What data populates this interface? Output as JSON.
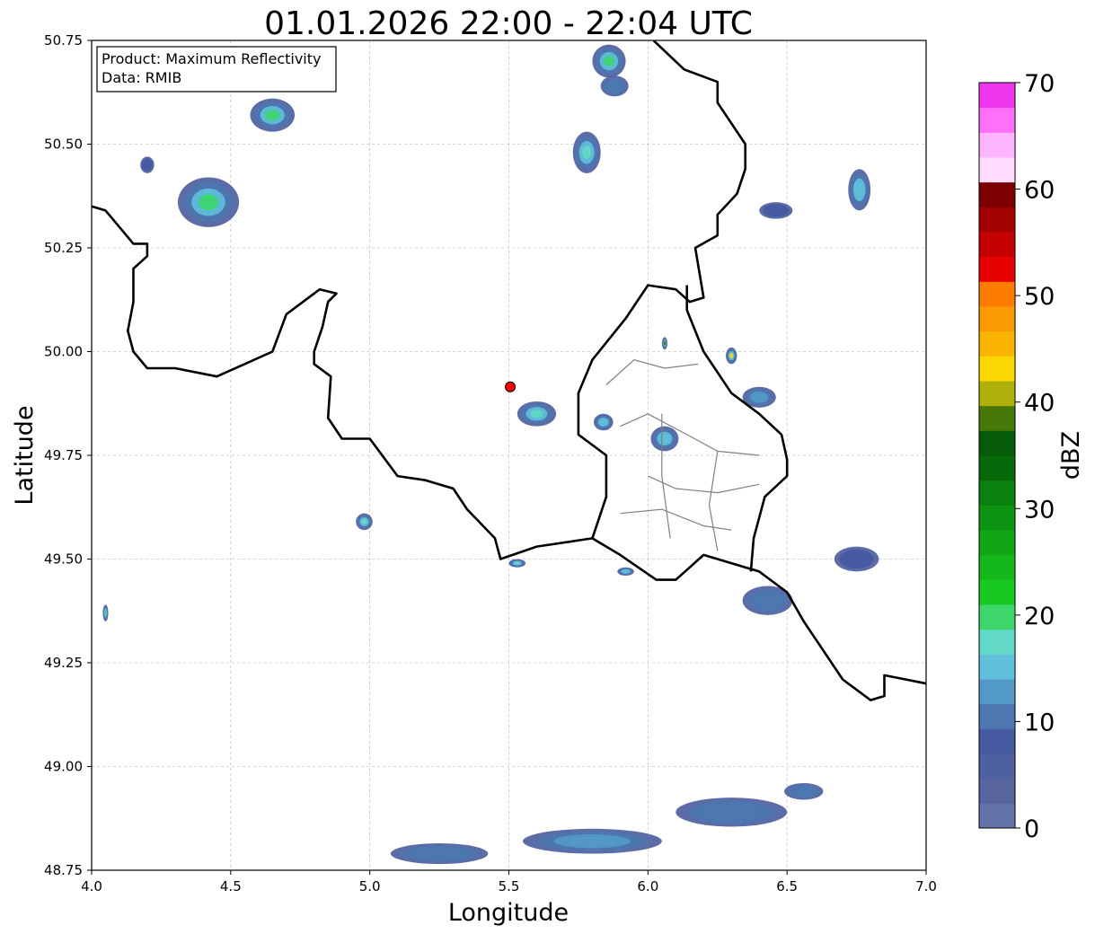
{
  "chart_data": {
    "type": "heatmap",
    "title": "01.01.2026 22:00 - 22:04 UTC",
    "xlabel": "Longitude",
    "ylabel": "Latitude",
    "xlim": [
      4.0,
      7.0
    ],
    "ylim": [
      48.75,
      50.75
    ],
    "xticks": [
      "4.0",
      "4.5",
      "5.0",
      "5.5",
      "6.0",
      "6.5",
      "7.0"
    ],
    "yticks": [
      "48.75",
      "49.00",
      "49.25",
      "49.50",
      "49.75",
      "50.00",
      "50.25",
      "50.50",
      "50.75"
    ],
    "grid": true,
    "annotation": {
      "line1": "Product: Maximum Reflectivity",
      "line2": "Data: RMIB"
    },
    "radar_site": {
      "lon": 5.505,
      "lat": 49.915,
      "color": "#ff0000"
    },
    "colorbar": {
      "label": "dBZ",
      "range": [
        0,
        70
      ],
      "step": 2.5,
      "ticks": [
        "0",
        "10",
        "20",
        "30",
        "40",
        "50",
        "60",
        "70"
      ],
      "colors": [
        "#6272a8",
        "#58659f",
        "#4e60a0",
        "#465aa2",
        "#4c77b0",
        "#5399c5",
        "#60bfdb",
        "#62d9c7",
        "#3dd66a",
        "#17c920",
        "#14b81b",
        "#11a615",
        "#0d9412",
        "#0b800f",
        "#066a0b",
        "#065b09",
        "#457808",
        "#b0b00a",
        "#fbd700",
        "#fbb400",
        "#fb9a00",
        "#fc7c00",
        "#e60000",
        "#c40000",
        "#a30000",
        "#7d0000",
        "#ffdcff",
        "#ffb4ff",
        "#ff6ff8",
        "#ee36ee"
      ]
    },
    "echoes": [
      {
        "lon": 4.65,
        "lat": 50.57,
        "w": 0.16,
        "h": 0.08,
        "dbz": 21
      },
      {
        "lon": 4.42,
        "lat": 50.36,
        "w": 0.22,
        "h": 0.12,
        "dbz": 22
      },
      {
        "lon": 4.2,
        "lat": 50.45,
        "w": 0.05,
        "h": 0.04,
        "dbz": 9
      },
      {
        "lon": 5.86,
        "lat": 50.7,
        "w": 0.12,
        "h": 0.08,
        "dbz": 21
      },
      {
        "lon": 5.88,
        "lat": 50.64,
        "w": 0.1,
        "h": 0.05,
        "dbz": 12
      },
      {
        "lon": 5.78,
        "lat": 50.48,
        "w": 0.1,
        "h": 0.1,
        "dbz": 19
      },
      {
        "lon": 5.6,
        "lat": 49.85,
        "w": 0.14,
        "h": 0.06,
        "dbz": 19
      },
      {
        "lon": 5.84,
        "lat": 49.83,
        "w": 0.07,
        "h": 0.04,
        "dbz": 15
      },
      {
        "lon": 6.06,
        "lat": 49.79,
        "w": 0.1,
        "h": 0.06,
        "dbz": 16
      },
      {
        "lon": 6.4,
        "lat": 49.89,
        "w": 0.12,
        "h": 0.05,
        "dbz": 14
      },
      {
        "lon": 6.76,
        "lat": 50.39,
        "w": 0.08,
        "h": 0.1,
        "dbz": 16
      },
      {
        "lon": 6.46,
        "lat": 50.34,
        "w": 0.12,
        "h": 0.04,
        "dbz": 8
      },
      {
        "lon": 6.75,
        "lat": 49.5,
        "w": 0.16,
        "h": 0.06,
        "dbz": 9
      },
      {
        "lon": 6.43,
        "lat": 49.4,
        "w": 0.18,
        "h": 0.07,
        "dbz": 12
      },
      {
        "lon": 5.25,
        "lat": 48.79,
        "w": 0.35,
        "h": 0.05,
        "dbz": 12
      },
      {
        "lon": 5.8,
        "lat": 48.82,
        "w": 0.5,
        "h": 0.06,
        "dbz": 13
      },
      {
        "lon": 6.3,
        "lat": 48.89,
        "w": 0.4,
        "h": 0.07,
        "dbz": 12
      },
      {
        "lon": 6.56,
        "lat": 48.94,
        "w": 0.14,
        "h": 0.04,
        "dbz": 10
      },
      {
        "lon": 4.98,
        "lat": 49.59,
        "w": 0.06,
        "h": 0.04,
        "dbz": 19
      },
      {
        "lon": 4.05,
        "lat": 49.37,
        "w": 0.02,
        "h": 0.04,
        "dbz": 21
      },
      {
        "lon": 6.3,
        "lat": 49.99,
        "w": 0.04,
        "h": 0.04,
        "dbz": 45
      },
      {
        "lon": 6.06,
        "lat": 50.02,
        "w": 0.02,
        "h": 0.03,
        "dbz": 40
      },
      {
        "lon": 5.53,
        "lat": 49.49,
        "w": 0.06,
        "h": 0.02,
        "dbz": 18
      },
      {
        "lon": 5.92,
        "lat": 49.47,
        "w": 0.06,
        "h": 0.02,
        "dbz": 17
      }
    ],
    "borders": {
      "country": [
        [
          [
            4.0,
            50.35
          ],
          [
            4.05,
            50.34
          ],
          [
            4.1,
            50.3
          ],
          [
            4.15,
            50.26
          ],
          [
            4.2,
            50.26
          ],
          [
            4.2,
            50.23
          ],
          [
            4.15,
            50.2
          ],
          [
            4.15,
            50.12
          ],
          [
            4.13,
            50.05
          ],
          [
            4.15,
            50.0
          ],
          [
            4.2,
            49.96
          ],
          [
            4.3,
            49.96
          ],
          [
            4.45,
            49.94
          ],
          [
            4.55,
            49.97
          ],
          [
            4.65,
            50.0
          ],
          [
            4.7,
            50.09
          ],
          [
            4.82,
            50.15
          ],
          [
            4.88,
            50.14
          ],
          [
            4.85,
            50.12
          ],
          [
            4.83,
            50.06
          ],
          [
            4.8,
            50.0
          ],
          [
            4.8,
            49.97
          ],
          [
            4.86,
            49.94
          ],
          [
            4.85,
            49.84
          ],
          [
            4.9,
            49.79
          ],
          [
            5.0,
            49.79
          ],
          [
            5.1,
            49.7
          ],
          [
            5.2,
            49.69
          ],
          [
            5.3,
            49.67
          ],
          [
            5.35,
            49.62
          ],
          [
            5.45,
            49.55
          ],
          [
            5.47,
            49.5
          ],
          [
            5.6,
            49.53
          ],
          [
            5.8,
            49.55
          ],
          [
            5.9,
            49.51
          ],
          [
            6.03,
            49.45
          ],
          [
            6.1,
            49.45
          ],
          [
            6.2,
            49.51
          ],
          [
            6.3,
            49.49
          ],
          [
            6.4,
            49.47
          ],
          [
            6.5,
            49.42
          ],
          [
            6.56,
            49.35
          ],
          [
            6.65,
            49.26
          ],
          [
            6.7,
            49.21
          ],
          [
            6.8,
            49.16
          ],
          [
            6.85,
            49.17
          ],
          [
            6.85,
            49.22
          ],
          [
            7.0,
            49.2
          ]
        ],
        [
          [
            5.8,
            49.55
          ],
          [
            5.85,
            49.65
          ],
          [
            5.85,
            49.75
          ],
          [
            5.75,
            49.8
          ],
          [
            5.75,
            49.9
          ],
          [
            5.8,
            49.98
          ],
          [
            5.92,
            50.08
          ],
          [
            6.0,
            50.16
          ],
          [
            6.1,
            50.15
          ],
          [
            6.15,
            50.12
          ],
          [
            6.2,
            50.13
          ],
          [
            6.17,
            50.25
          ],
          [
            6.25,
            50.28
          ],
          [
            6.25,
            50.33
          ],
          [
            6.32,
            50.38
          ],
          [
            6.35,
            50.44
          ],
          [
            6.35,
            50.5
          ],
          [
            6.25,
            50.6
          ],
          [
            6.25,
            50.65
          ],
          [
            6.13,
            50.68
          ],
          [
            6.02,
            50.75
          ]
        ],
        [
          [
            6.14,
            50.16
          ],
          [
            6.14,
            50.1
          ],
          [
            6.2,
            50.0
          ],
          [
            6.3,
            49.9
          ],
          [
            6.4,
            49.85
          ],
          [
            6.48,
            49.8
          ],
          [
            6.5,
            49.74
          ],
          [
            6.5,
            49.7
          ],
          [
            6.42,
            49.65
          ],
          [
            6.38,
            49.55
          ],
          [
            6.37,
            49.47
          ]
        ]
      ],
      "inner": [
        [
          [
            5.85,
            49.92
          ],
          [
            5.95,
            49.98
          ],
          [
            6.06,
            49.96
          ],
          [
            6.18,
            49.97
          ]
        ],
        [
          [
            5.9,
            49.82
          ],
          [
            6.0,
            49.85
          ],
          [
            6.14,
            49.8
          ],
          [
            6.25,
            49.76
          ],
          [
            6.4,
            49.75
          ]
        ],
        [
          [
            6.0,
            49.7
          ],
          [
            6.1,
            49.67
          ],
          [
            6.25,
            49.66
          ],
          [
            6.4,
            49.68
          ]
        ],
        [
          [
            5.9,
            49.61
          ],
          [
            6.05,
            49.62
          ],
          [
            6.2,
            49.58
          ],
          [
            6.3,
            49.57
          ]
        ],
        [
          [
            6.05,
            49.85
          ],
          [
            6.05,
            49.7
          ],
          [
            6.08,
            49.55
          ]
        ],
        [
          [
            6.25,
            49.76
          ],
          [
            6.22,
            49.63
          ],
          [
            6.25,
            49.52
          ]
        ]
      ]
    }
  }
}
